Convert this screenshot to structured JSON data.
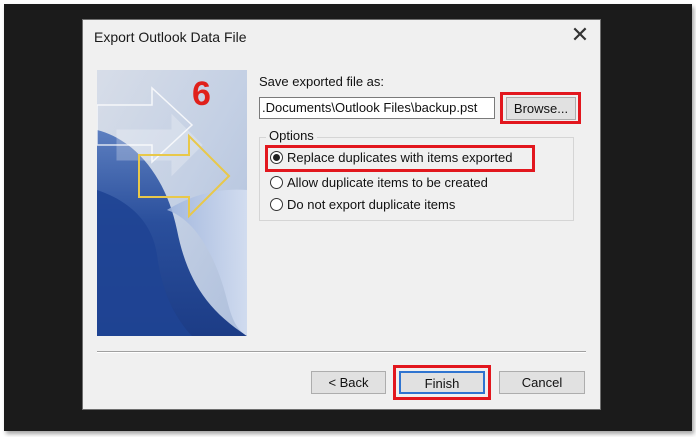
{
  "window": {
    "title": "Export Outlook Data File",
    "close_glyph": "✕"
  },
  "step_number": "6",
  "save": {
    "label": "Save exported file as:",
    "path_value": ".Documents\\Outlook Files\\backup.pst",
    "browse_label": "Browse..."
  },
  "options": {
    "title": "Options",
    "items": [
      {
        "label": "Replace duplicates with items exported",
        "checked": true
      },
      {
        "label": "Allow duplicate items to be created",
        "checked": false
      },
      {
        "label": "Do not export duplicate items",
        "checked": false
      }
    ]
  },
  "buttons": {
    "back": "< Back",
    "finish": "Finish",
    "cancel": "Cancel"
  },
  "colors": {
    "highlight": "#e2171e",
    "step_number": "#e0201b",
    "focus": "#2f74d0",
    "artwork_blue": "#2a4f9c",
    "artwork_arrow": "#e8c84a"
  }
}
